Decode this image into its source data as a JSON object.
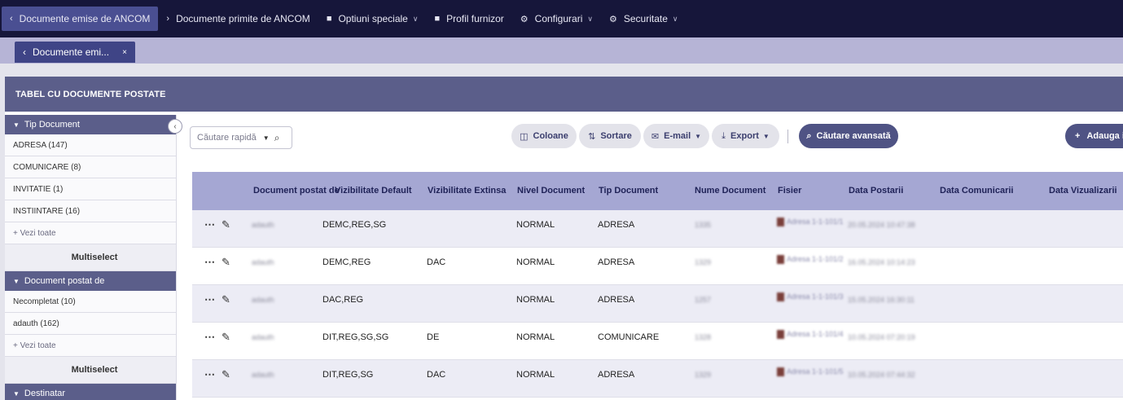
{
  "topnav": {
    "items": [
      {
        "label": "Documente emise de ANCOM",
        "icon": "chevron-left-icon",
        "active": true
      },
      {
        "label": "Documente primite de ANCOM",
        "icon": "chevron-right-icon"
      },
      {
        "label": "Optiuni speciale",
        "icon": "document-icon",
        "dropdown": true
      },
      {
        "label": "Profil furnizor",
        "icon": "document-icon"
      },
      {
        "label": "Configurari",
        "icon": "gear-icon",
        "dropdown": true
      },
      {
        "label": "Securitate",
        "icon": "gear-icon",
        "dropdown": true
      }
    ]
  },
  "tabs": [
    {
      "label": "Documente emi...",
      "close": "×"
    }
  ],
  "panel": {
    "title": "TABEL CU DOCUMENTE POSTATE"
  },
  "sidebar": {
    "groups": [
      {
        "title": "Tip Document",
        "items": [
          "ADRESA (147)",
          "COMUNICARE (8)",
          "INVITATIE (1)",
          "INSTIINTARE (16)"
        ],
        "more": "+ Vezi toate",
        "multiselect": "Multiselect"
      },
      {
        "title": "Document postat de",
        "items": [
          "Necompletat (10)",
          "adauth (162)"
        ],
        "more": "+ Vezi toate",
        "multiselect": "Multiselect"
      },
      {
        "title": "Destinatar"
      }
    ]
  },
  "toolbar": {
    "search_placeholder": "Căutare rapidă",
    "columns": "Coloane",
    "sort": "Sortare",
    "email": "E-mail",
    "export": "Export",
    "advanced": "Căutare avansată",
    "add": "Adauga i"
  },
  "table": {
    "headers": [
      "Document postat de",
      "Vizibilitate Default",
      "Vizibilitate Extinsa",
      "Nivel Document",
      "Tip Document",
      "Nume Document",
      "Fisier",
      "Data Postarii",
      "Data Comunicarii",
      "Data Vizualizarii"
    ],
    "rows": [
      {
        "posted_by": "adauth",
        "vis_default": "DEMC,REG,SG",
        "vis_ext": "",
        "level": "NORMAL",
        "type": "ADRESA",
        "name": "1335",
        "file": "Adresa 1-1-101/1",
        "date_posted": "20.05.2024 10:47:38",
        "date_comm": "",
        "date_view": ""
      },
      {
        "posted_by": "adauth",
        "vis_default": "DEMC,REG",
        "vis_ext": "DAC",
        "level": "NORMAL",
        "type": "ADRESA",
        "name": "1329",
        "file": "Adresa 1-1-101/2",
        "date_posted": "16.05.2024 10:14:23",
        "date_comm": "",
        "date_view": ""
      },
      {
        "posted_by": "adauth",
        "vis_default": "DAC,REG",
        "vis_ext": "",
        "level": "NORMAL",
        "type": "ADRESA",
        "name": "1257",
        "file": "Adresa 1-1-101/3",
        "date_posted": "15.05.2024 16:30:11",
        "date_comm": "",
        "date_view": ""
      },
      {
        "posted_by": "adauth",
        "vis_default": "DIT,REG,SG,SG",
        "vis_ext": "DE",
        "level": "NORMAL",
        "type": "COMUNICARE",
        "name": "1328",
        "file": "Adresa 1-1-101/4",
        "date_posted": "10.05.2024 07:20:19",
        "date_comm": "",
        "date_view": ""
      },
      {
        "posted_by": "adauth",
        "vis_default": "DIT,REG,SG",
        "vis_ext": "DAC",
        "level": "NORMAL",
        "type": "ADRESA",
        "name": "1329",
        "file": "Adresa 1-1-101/5",
        "date_posted": "10.05.2024 07:44:32",
        "date_comm": "",
        "date_view": ""
      }
    ]
  }
}
